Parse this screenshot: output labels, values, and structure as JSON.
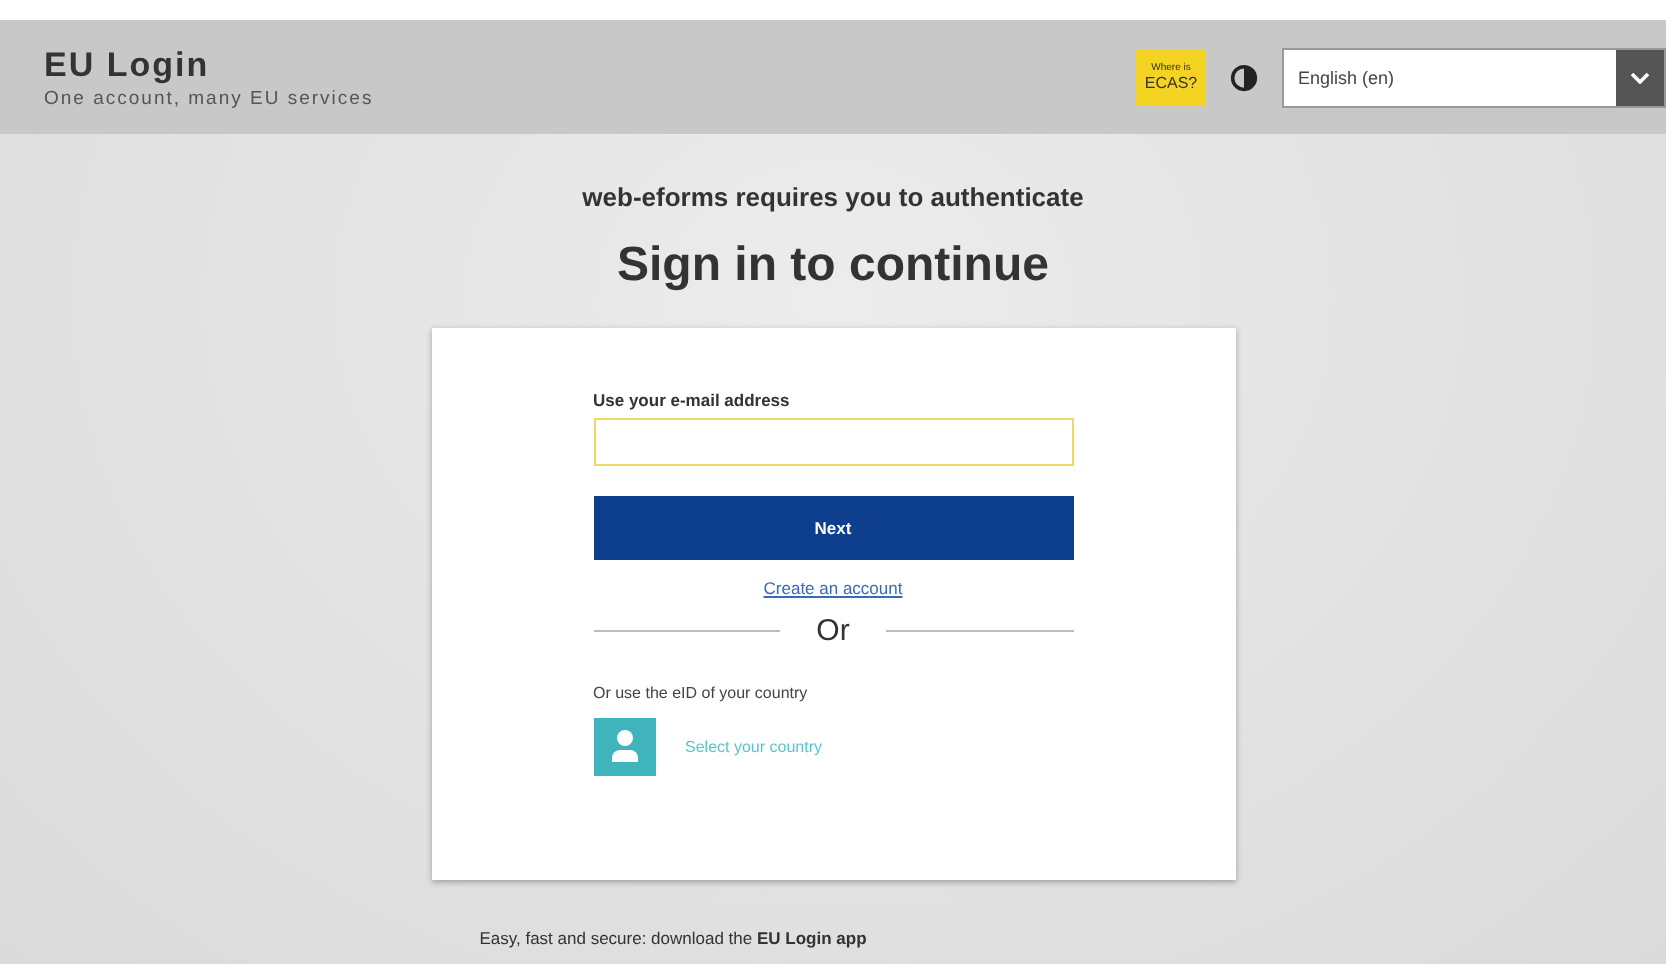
{
  "header": {
    "title": "EU Login",
    "subtitle": "One account, many EU services",
    "ecas_badge": {
      "line1": "Where is",
      "line2": "ECAS?"
    },
    "language": {
      "value": "English (en)"
    }
  },
  "intro": "web-eforms requires you to authenticate",
  "heading": "Sign in to continue",
  "login_card": {
    "email_label": "Use your e-mail address",
    "next_button": "Next",
    "create_account_link": "Create an account",
    "separator": "Or",
    "eid_label": "Or use the eID of your country",
    "eid_link": "Select your country"
  },
  "footer_text": "Easy, fast and secure: download the **EU Login app**"
}
